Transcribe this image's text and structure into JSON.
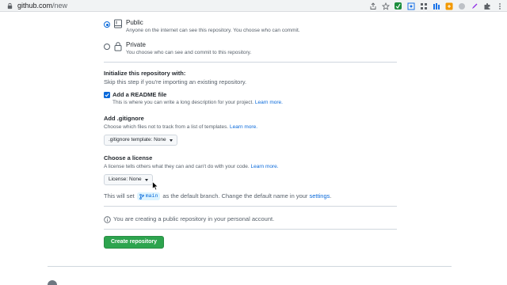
{
  "browser": {
    "url_host": "github.com",
    "url_path": "/new",
    "icons": [
      "share-icon",
      "star-icon",
      "extension-icon",
      "screenshot-icon",
      "grid-icon",
      "translate-icon",
      "app-icon",
      "circle-icon",
      "pen-icon",
      "puzzle-icon",
      "menu-icon"
    ]
  },
  "visibility": {
    "public": {
      "title": "Public",
      "description": "Anyone on the internet can see this repository. You choose who can commit.",
      "selected": true
    },
    "private": {
      "title": "Private",
      "description": "You choose who can see and commit to this repository.",
      "selected": false
    }
  },
  "initialize": {
    "title": "Initialize this repository with:",
    "subtitle": "Skip this step if you're importing an existing repository.",
    "readme": {
      "label": "Add a README file",
      "description": "This is where you can write a long description for your project.",
      "link": "Learn more.",
      "checked": true
    }
  },
  "gitignore": {
    "title": "Add .gitignore",
    "description": "Choose which files not to track from a list of templates.",
    "link": "Learn more.",
    "select_label": ".gitignore template: None"
  },
  "license": {
    "title": "Choose a license",
    "description": "A license tells others what they can and can't do with your code.",
    "link": "Learn more.",
    "select_label": "License: None"
  },
  "branch": {
    "prefix": "This will set",
    "branch_name": "main",
    "middle": "as the default branch. Change the default name in your",
    "settings_link": "settings",
    "suffix": "."
  },
  "notice": {
    "text": "You are creating a public repository in your personal account."
  },
  "actions": {
    "create_label": "Create repository"
  },
  "colors": {
    "primary_button": "#2da44e",
    "link": "#0969da",
    "checkbox": "#0969da"
  }
}
